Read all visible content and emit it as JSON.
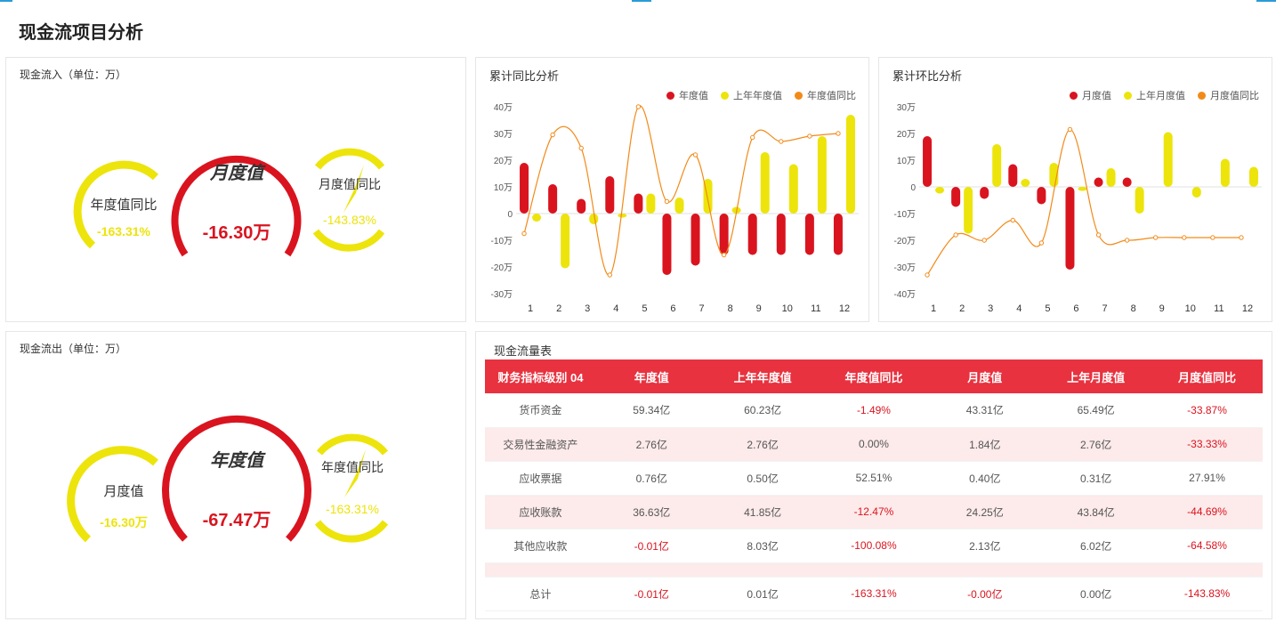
{
  "page": {
    "title": "现金流项目分析"
  },
  "colors": {
    "red": "#d9141f",
    "yellow": "#ede40b",
    "orange": "#f28a19",
    "header_red": "#e8323f"
  },
  "inflow": {
    "title": "现金流入（单位：万）",
    "main": {
      "label": "月度值",
      "value": "-16.30万"
    },
    "left": {
      "label": "年度值同比",
      "value": "-163.31%"
    },
    "right": {
      "label": "月度值同比",
      "value": "-143.83%"
    }
  },
  "outflow": {
    "title": "现金流出（单位：万）",
    "main": {
      "label": "年度值",
      "value": "-67.47万"
    },
    "left": {
      "label": "月度值",
      "value": "-16.30万"
    },
    "right": {
      "label": "年度值同比",
      "value": "-163.31%"
    }
  },
  "chart_data": [
    {
      "type": "bar",
      "title": "累计同比分析",
      "categories": [
        "1",
        "2",
        "3",
        "4",
        "5",
        "6",
        "7",
        "8",
        "9",
        "10",
        "11",
        "12"
      ],
      "ylim": [
        -30,
        40
      ],
      "yticks": [
        40,
        30,
        20,
        10,
        0,
        -10,
        -20,
        -30
      ],
      "ytick_labels": [
        "40万",
        "30万",
        "20万",
        "10万",
        "0",
        "-10万",
        "-20万",
        "-30万"
      ],
      "legend_position": "top-right",
      "series": [
        {
          "name": "年度值",
          "type": "bar",
          "color": "#d9141f",
          "values": [
            19,
            11,
            5.5,
            14,
            7.5,
            -23,
            -19.5,
            -15.5,
            -15.5,
            -15.5,
            -15.5,
            -15.5
          ]
        },
        {
          "name": "上年年度值",
          "type": "bar",
          "color": "#ede40b",
          "values": [
            -3,
            -20.5,
            -4,
            -1.5,
            7.5,
            6,
            13,
            2.5,
            23,
            18.5,
            29,
            37
          ]
        },
        {
          "name": "年度值同比",
          "type": "line",
          "color": "#f28a19",
          "values": [
            -7.5,
            29.5,
            24.5,
            -23,
            40,
            4.5,
            22,
            -15.5,
            28.5,
            27,
            29,
            30
          ]
        }
      ]
    },
    {
      "type": "bar",
      "title": "累计环比分析",
      "categories": [
        "1",
        "2",
        "3",
        "4",
        "5",
        "6",
        "7",
        "8",
        "9",
        "10",
        "11",
        "12"
      ],
      "ylim": [
        -40,
        30
      ],
      "yticks": [
        30,
        20,
        10,
        0,
        -10,
        -20,
        -30,
        -40
      ],
      "ytick_labels": [
        "30万",
        "20万",
        "10万",
        "0",
        "-10万",
        "-20万",
        "-30万",
        "-40万"
      ],
      "legend_position": "top-right",
      "series": [
        {
          "name": "月度值",
          "type": "bar",
          "color": "#d9141f",
          "values": [
            19,
            -7.5,
            -4.5,
            8.5,
            -6.5,
            -31,
            3.5,
            3.5,
            0,
            0,
            0,
            0
          ]
        },
        {
          "name": "上年月度值",
          "type": "bar",
          "color": "#ede40b",
          "values": [
            -2.5,
            -17.5,
            16,
            3,
            9,
            -1.5,
            7,
            -10,
            20.5,
            -4,
            10.5,
            7.5
          ]
        },
        {
          "name": "月度值同比",
          "type": "line",
          "color": "#f28a19",
          "values": [
            -33,
            -18,
            -20,
            -12.5,
            -21,
            21.5,
            -18,
            -20,
            -19,
            -19,
            -19,
            -19
          ]
        }
      ]
    },
    {
      "type": "table",
      "title": "现金流量表",
      "columns": [
        "财务指标级别 04",
        "年度值",
        "上年年度值",
        "年度值同比",
        "月度值",
        "上年月度值",
        "月度值同比"
      ],
      "rows": [
        [
          "货币资金",
          "59.34亿",
          "60.23亿",
          "-1.49%",
          "43.31亿",
          "65.49亿",
          "-33.87%"
        ],
        [
          "交易性金融资产",
          "2.76亿",
          "2.76亿",
          "0.00%",
          "1.84亿",
          "2.76亿",
          "-33.33%"
        ],
        [
          "应收票据",
          "0.76亿",
          "0.50亿",
          "52.51%",
          "0.40亿",
          "0.31亿",
          "27.91%"
        ],
        [
          "应收账款",
          "36.63亿",
          "41.85亿",
          "-12.47%",
          "24.25亿",
          "43.84亿",
          "-44.69%"
        ],
        [
          "其他应收款",
          "-0.01亿",
          "8.03亿",
          "-100.08%",
          "2.13亿",
          "6.02亿",
          "-64.58%"
        ],
        [
          "",
          "",
          "",
          "",
          "",
          "",
          ""
        ],
        [
          "总计",
          "-0.01亿",
          "0.01亿",
          "-163.31%",
          "-0.00亿",
          "0.00亿",
          "-143.83%"
        ]
      ]
    }
  ]
}
